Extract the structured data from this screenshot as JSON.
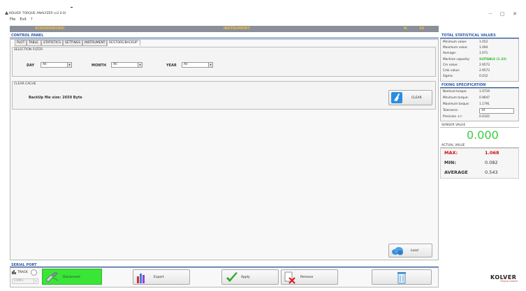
{
  "window": {
    "title": "KOLVER TORQUE ANALYZER (v2.0.0)",
    "minimize_glyph": "—",
    "maximize_glyph": "▢",
    "close_glyph": "✕"
  },
  "menu": [
    "File",
    "Exit",
    "?"
  ],
  "header": {
    "screwdriver_label": "SCREWDRIVER:",
    "instrument_label": "INSTRUMENT:",
    "n_label": "N.",
    "n_value": "10"
  },
  "control_panel": {
    "title": "CONTROL PANEL",
    "tabs": [
      "PLOT",
      "TABLE",
      "STATISTICS",
      "SETTINGS",
      "INSTRUMENT",
      "RESTORE/BACKUP"
    ],
    "active_tab": "RESTORE/BACKUP",
    "selection_filter": {
      "title": "SELECTION FILTER",
      "day_label": "DAY",
      "day_value": "All",
      "month_label": "MONTH",
      "month_value": "All",
      "year_label": "YEAR",
      "year_value": "All"
    },
    "clear_cache": {
      "title": "CLEAR CACHE",
      "backup_text": "BackUp file size: 2659 Byte",
      "clear_button": "CLEAR"
    },
    "load_button": "Load"
  },
  "serial_port": {
    "title": "SERIAL PORT",
    "track_label": "TRACK",
    "com_value": "COM1",
    "status": "Disconnect",
    "export_button": "Export",
    "apply_button": "Apply",
    "remove_button": "Remove"
  },
  "brand": {
    "logo_text": "KOLVER",
    "logo_tagline": "Torque control"
  },
  "total_statistics": {
    "title": "TOTAL STATISTICAL VALUES",
    "rows": [
      {
        "label": "Minimum value:",
        "value": "1.052"
      },
      {
        "label": "Maximum value:",
        "value": "1.094"
      },
      {
        "label": "Average:",
        "value": "1.071"
      },
      {
        "label": "Machine capacity:",
        "value": "SUITABLE (1.33)"
      },
      {
        "label": "Cm value:",
        "value": "2.9573"
      },
      {
        "label": "Cmk value:",
        "value": "2.9573"
      },
      {
        "label": "Sigma:",
        "value": "0.012"
      }
    ]
  },
  "fixing_specification": {
    "title": "FIXING SPECIFICATION",
    "rows": [
      {
        "label": "Nominal torque:",
        "value": "1.0719"
      },
      {
        "label": "Minimum torque:",
        "value": "0.9647"
      },
      {
        "label": "Maximum torque:",
        "value": "1.1791"
      },
      {
        "label": "Tolerance:",
        "value": "10"
      },
      {
        "label": "Precision +/-:",
        "value": "0.0325"
      }
    ]
  },
  "sensor": {
    "title": "SENSOR VALUE",
    "value": "0.000"
  },
  "actual": {
    "title": "ACTUAL VALUE",
    "max_label": "MAX:",
    "max_value": "1.068",
    "min_label": "MIN:",
    "min_value": "0.082",
    "avg_label": "AVERAGE",
    "avg_value": "0.543"
  },
  "colors": {
    "accent_blue": "#2a58a8",
    "header_gold": "#f0c040",
    "header_gray": "#8a8f99",
    "status_green": "#39e636",
    "max_red": "#cc1111",
    "sensor_green": "#3dcc3d",
    "suitable_green": "#2eb82e"
  }
}
